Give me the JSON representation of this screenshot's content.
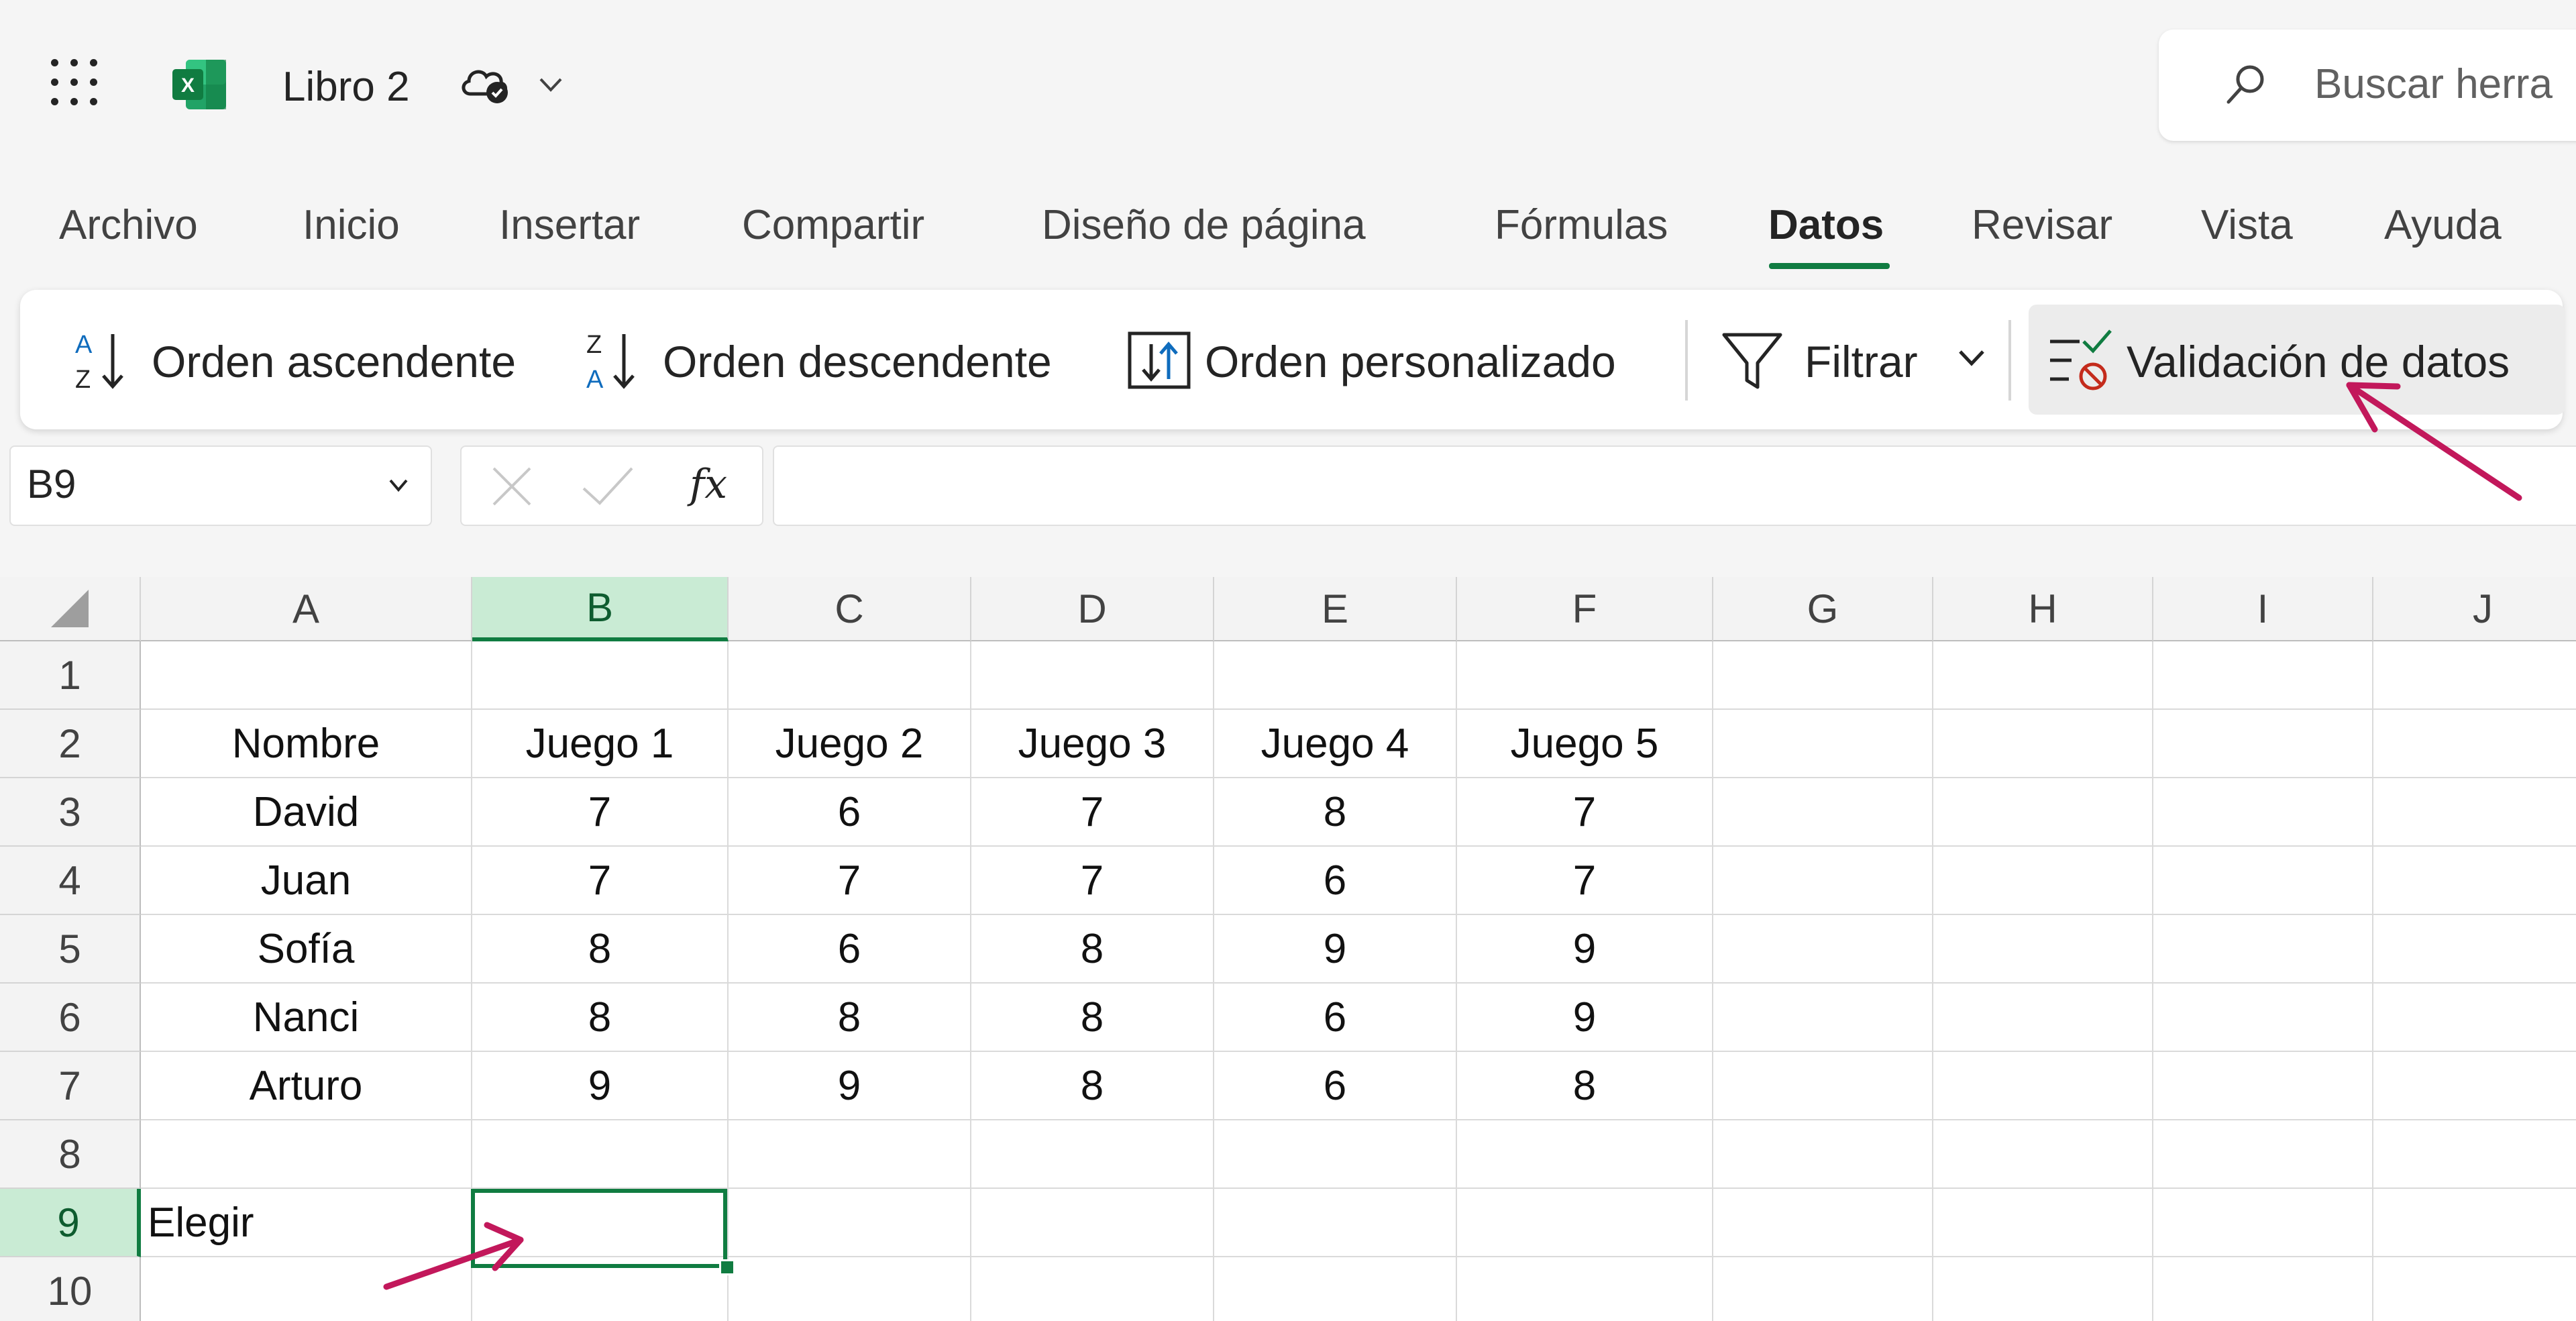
{
  "app": {
    "doc_title": "Libro 2",
    "search_placeholder": "Buscar herra"
  },
  "tabs": [
    {
      "label": "Archivo",
      "active": false
    },
    {
      "label": "Inicio",
      "active": false
    },
    {
      "label": "Insertar",
      "active": false
    },
    {
      "label": "Compartir",
      "active": false
    },
    {
      "label": "Diseño de página",
      "active": false
    },
    {
      "label": "Fórmulas",
      "active": false
    },
    {
      "label": "Datos",
      "active": true
    },
    {
      "label": "Revisar",
      "active": false
    },
    {
      "label": "Vista",
      "active": false
    },
    {
      "label": "Ayuda",
      "active": false
    }
  ],
  "ribbon": {
    "sort_asc": "Orden ascendente",
    "sort_desc": "Orden descendente",
    "sort_custom": "Orden personalizado",
    "filter": "Filtrar",
    "data_validation": "Validación de datos"
  },
  "formula_bar": {
    "name_box": "B9",
    "fx_label": "fx",
    "formula": ""
  },
  "sheet": {
    "columns": [
      "A",
      "B",
      "C",
      "D",
      "E",
      "F",
      "G",
      "H",
      "I",
      "J"
    ],
    "rows": [
      "1",
      "2",
      "3",
      "4",
      "5",
      "6",
      "7",
      "8",
      "9",
      "10"
    ],
    "selected_cell": "B9",
    "cells": [
      [
        "",
        "",
        "",
        "",
        "",
        "",
        "",
        "",
        "",
        ""
      ],
      [
        "Nombre",
        "Juego 1",
        "Juego 2",
        "Juego 3",
        "Juego 4",
        "Juego 5",
        "",
        "",
        "",
        ""
      ],
      [
        "David",
        "7",
        "6",
        "7",
        "8",
        "7",
        "",
        "",
        "",
        ""
      ],
      [
        "Juan",
        "7",
        "7",
        "7",
        "6",
        "7",
        "",
        "",
        "",
        ""
      ],
      [
        "Sofía",
        "8",
        "6",
        "8",
        "9",
        "9",
        "",
        "",
        "",
        ""
      ],
      [
        "Nanci",
        "8",
        "8",
        "8",
        "6",
        "9",
        "",
        "",
        "",
        ""
      ],
      [
        "Arturo",
        "9",
        "9",
        "8",
        "6",
        "8",
        "",
        "",
        "",
        ""
      ],
      [
        "",
        "",
        "",
        "",
        "",
        "",
        "",
        "",
        "",
        ""
      ],
      [
        "Elegir",
        "",
        "",
        "",
        "",
        "",
        "",
        "",
        "",
        ""
      ],
      [
        "",
        "",
        "",
        "",
        "",
        "",
        "",
        "",
        "",
        ""
      ]
    ]
  },
  "colors": {
    "accent": "#107c41",
    "annotation_arrow": "#c2185b"
  }
}
